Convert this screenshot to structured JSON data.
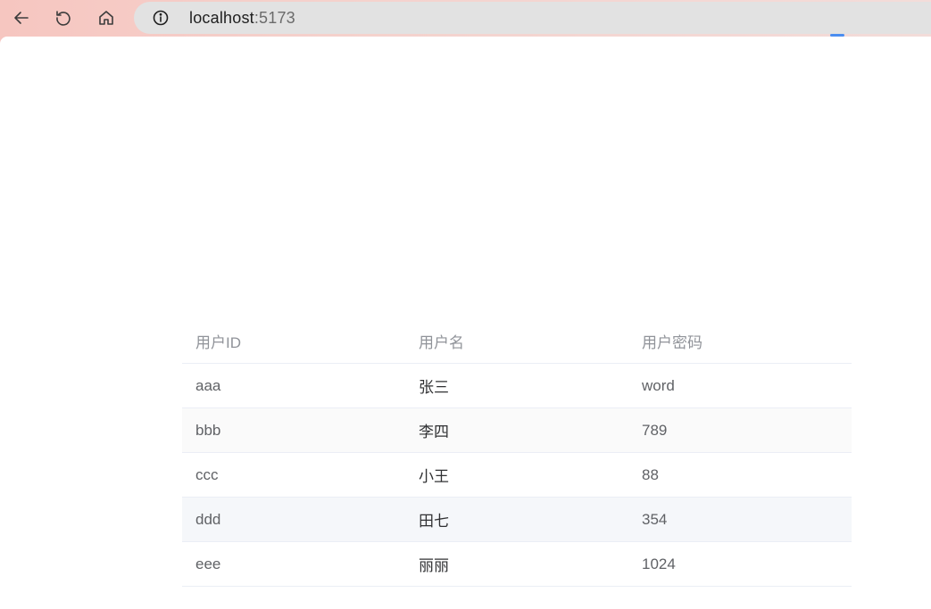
{
  "browser": {
    "url_host": "localhost",
    "url_port": ":5173",
    "icons": {
      "back": "arrow-left-icon",
      "reload": "reload-icon",
      "home": "home-icon",
      "info": "info-icon"
    }
  },
  "table": {
    "headers": [
      "用户ID",
      "用户名",
      "用户密码"
    ],
    "rows": [
      [
        "aaa",
        "张三",
        "word"
      ],
      [
        "bbb",
        "李四",
        "789"
      ],
      [
        "ccc",
        "小王",
        "88"
      ],
      [
        "ddd",
        "田七",
        "354"
      ],
      [
        "eee",
        "丽丽",
        "1024"
      ]
    ]
  },
  "colors": {
    "header_text": "#909399",
    "cell_text": "#606266",
    "border": "#ebeef5",
    "stripe": "#fafafa",
    "hover": "#f5f7fa"
  }
}
